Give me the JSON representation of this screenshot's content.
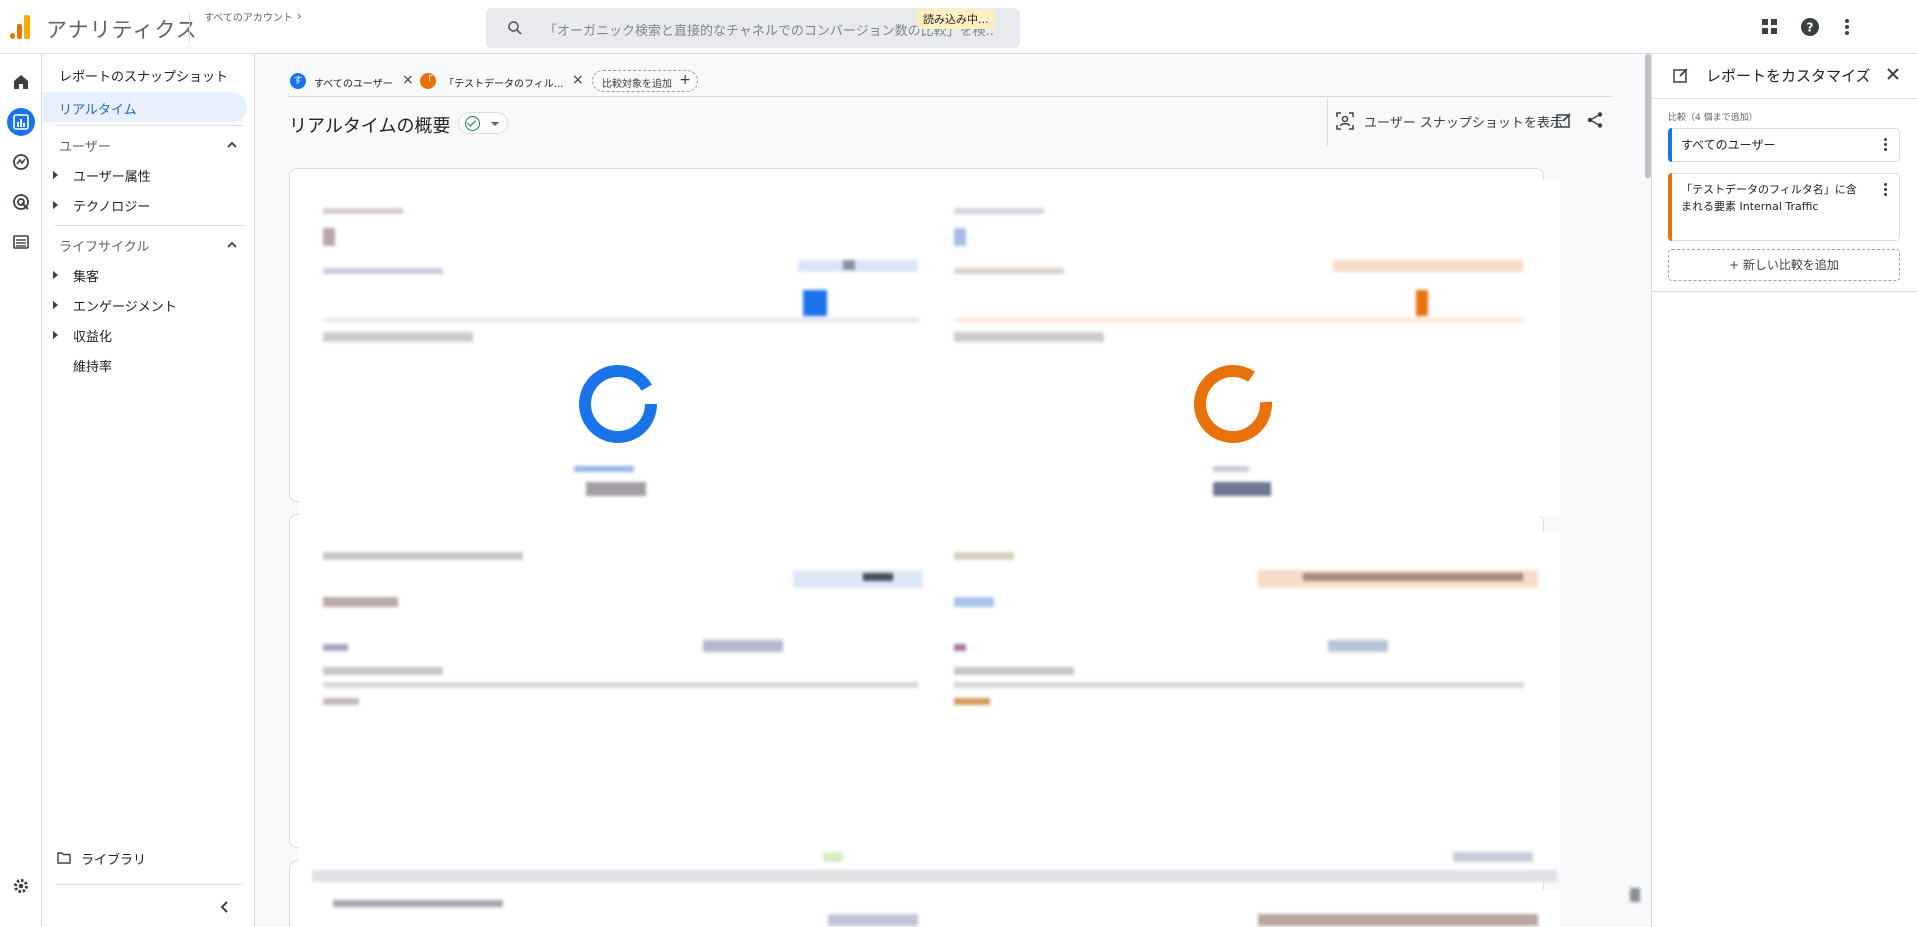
{
  "app": {
    "title": "アナリティクス",
    "account_crumb": "すべてのアカウント",
    "crumb_chevron": "›",
    "search_placeholder": "「オーガニック検索と直接的なチャネルでのコンバージョン数の比較」を検...",
    "loading_badge": "読み込み中..."
  },
  "nav": {
    "snapshot": "レポートのスナップショット",
    "realtime": "リアルタイム",
    "section_user": "ユーザー",
    "user_attributes": "ユーザー属性",
    "technology": "テクノロジー",
    "section_lifecycle": "ライフサイクル",
    "acquisition": "集客",
    "engagement": "エンゲージメント",
    "monetization": "収益化",
    "retention": "維持率",
    "library": "ライブラリ"
  },
  "main": {
    "chips": [
      {
        "initial": "す",
        "label": "すべてのユーザー",
        "color": "#1a73e8"
      },
      {
        "initial": "「",
        "label": "「テストデータのフィル...",
        "color": "#e8710a"
      }
    ],
    "add_comparison": "比較対象を追加",
    "page_title": "リアルタイムの概要",
    "snapshot_button": "ユーザー スナップショットを表示"
  },
  "right_panel": {
    "title": "レポートをカスタマイズ",
    "caption": "比較（4 個まで追加）",
    "comparisons": [
      {
        "label": "すべてのユーザー",
        "color": "#1a73e8"
      },
      {
        "label": "「テストデータのフィルタ名」に含まれる要素 Internal Traffic",
        "color": "#e8710a"
      }
    ],
    "add_new": "新しい比較を追加"
  },
  "colors": {
    "accent_blue": "#1a73e8",
    "accent_orange": "#e8710a"
  }
}
